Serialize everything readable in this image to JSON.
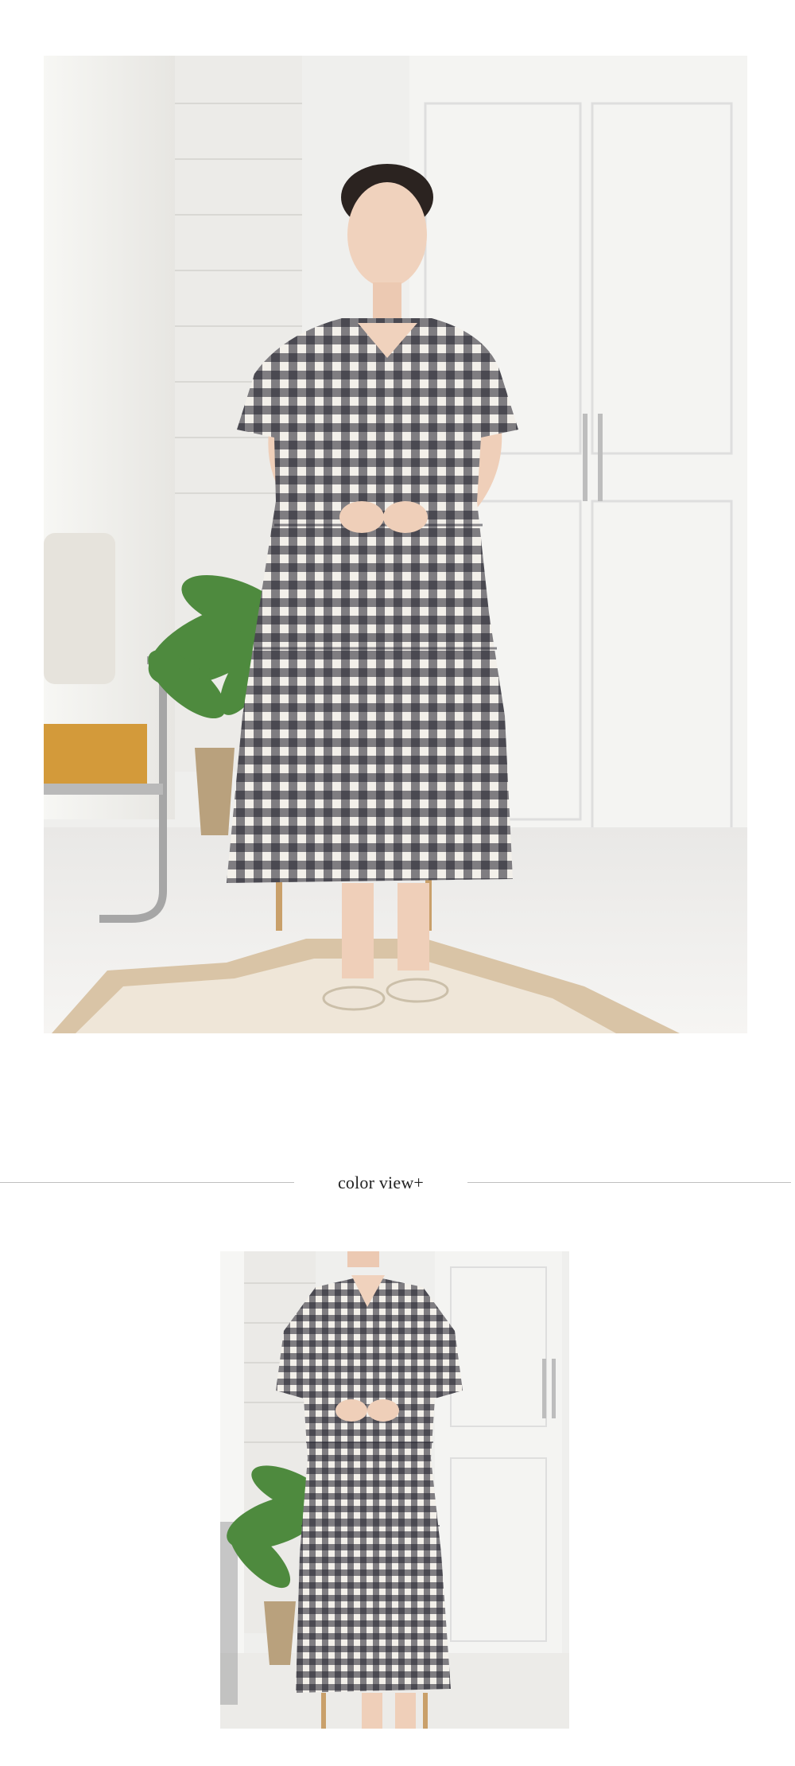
{
  "section_title": "color view+",
  "colors": {
    "background": "#ffffff",
    "divider": "#bfbfbf",
    "title_text": "#222222",
    "gingham_dark": "#1f1f2a",
    "gingham_light": "#f3f0ea"
  }
}
